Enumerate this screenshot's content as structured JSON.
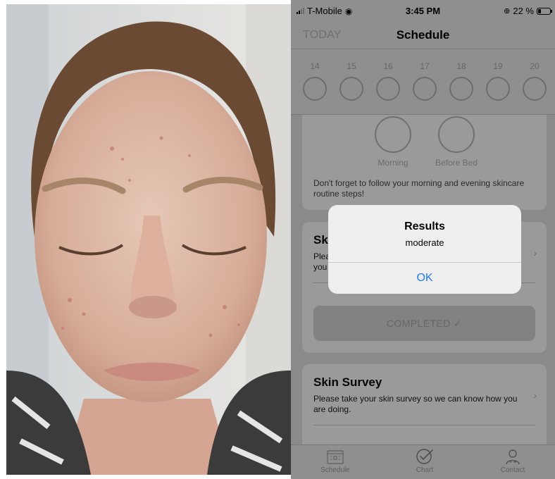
{
  "status_bar": {
    "carrier": "T-Mobile",
    "time": "3:45 PM",
    "battery_percent": "22 %",
    "battery_level": 0.22,
    "icons": [
      "signal-bars-icon",
      "wifi-icon",
      "orientation-lock-icon",
      "battery-icon"
    ]
  },
  "nav": {
    "today_label": "TODAY",
    "title": "Schedule"
  },
  "dates": [
    "14",
    "15",
    "16",
    "17",
    "18",
    "19",
    "20"
  ],
  "routine_card": {
    "morning_label": "Morning",
    "before_bed_label": "Before Bed",
    "note": "Don't forget to follow your morning and evening skincare routine steps!"
  },
  "photo_card": {
    "title_visible": "Sk",
    "desc_line1": "Plea",
    "desc_line2": "you",
    "completed_label": "COMPLETED ✓"
  },
  "survey_card": {
    "title": "Skin Survey",
    "description": "Please take your skin survey so we can know how you are doing."
  },
  "alert": {
    "title": "Results",
    "message": "moderate",
    "ok_label": "OK",
    "ok_color": "#1e7cf2"
  },
  "tabs": [
    {
      "label": "Schedule",
      "icon": "calendar-icon"
    },
    {
      "label": "Chart",
      "icon": "check-badge-icon"
    },
    {
      "label": "Contact",
      "icon": "doctor-icon"
    }
  ],
  "colors": {
    "dim_overlay": "#8f8f91",
    "alert_bg": "#efeff0"
  }
}
